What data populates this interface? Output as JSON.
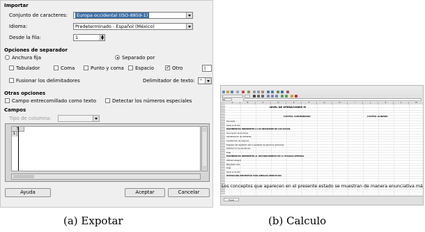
{
  "import_dialog": {
    "title": "Importar",
    "charset_label": "Conjunto de caracteres:",
    "charset_value": "Europa occidental (ISO-8859-1)",
    "language_label": "Idioma:",
    "language_value": "Predeterminado - Español (México)",
    "from_row_label": "Desde la fila:",
    "from_row_value": "1",
    "separator_section": "Opciones de separador",
    "fixed_width_label": "Anchura fija",
    "separated_by_label": "Separado por",
    "tab_label": "Tabulador",
    "comma_label": "Coma",
    "semicolon_label": "Punto y coma",
    "space_label": "Espacio",
    "other_label": "Otro",
    "other_value": "|",
    "merge_label": "Fusionar los delimitadores",
    "text_delim_label": "Delimitador de texto:",
    "text_delim_value": "\"",
    "other_section": "Otras opciones",
    "quoted_field_label": "Campo entrecomillado como texto",
    "detect_numbers_label": "Detectar los números especiales",
    "fields_section": "Campos",
    "column_type_label": "Tipo de columna:",
    "column_type_value": "",
    "preview_col": "S",
    "preview_row": "1",
    "help_button": "Ayuda",
    "ok_button": "Aceptar",
    "cancel_button": "Cancelar"
  },
  "spreadsheet": {
    "column_headers": [
      "A",
      "B",
      "C",
      "D",
      "E",
      "F",
      "G",
      "H",
      "I",
      "J",
      "K",
      "L",
      "M"
    ],
    "title_line": "NIVEL DE OPERACIONES M",
    "subtitle_1": "CAPITAL CONTRIBUIDO",
    "subtitle_2": "CAPITAL GANADO",
    "row_labels": [
      "Concepto",
      "Saldo al 31 DIC",
      "MOVIMIENTOS INHERENTES A LAS DECISIONES DE LOS SOCIOS",
      "Suscripción de acciones",
      "Capitalización de utilidades",
      "Constitución de reservas",
      "Traspaso del resultado neto a resultado de ejercicios anteriores",
      "Distribución de dividendos",
      "Total",
      "MOVIMIENTOS INHERENTES AL RECONOCIMIENTO DE LA UTILIDAD INTEGRAL",
      "Utilidad integral",
      "Resultado neto",
      "Total",
      "Saldo al 31 DIC",
      "ESTIMACIÓN PREVENTIVA PARA RIESGOS CREDITICIOS"
    ],
    "big_text": "Los conceptos que aparecen en el presente estado se muestran de manera enunciativa más no limitativa.",
    "sheet_tab": "Hoja1",
    "cell_ref": "A1"
  },
  "captions": {
    "a": "(a) Expotar",
    "b": "(b) Calculo"
  }
}
